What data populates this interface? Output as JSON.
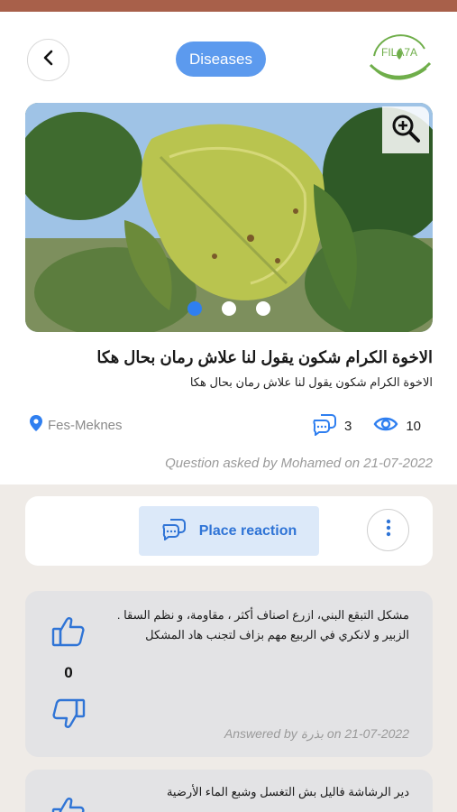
{
  "header": {
    "category_label": "Diseases",
    "logo_text": "FILA7A"
  },
  "post": {
    "title": "الاخوة الكرام شكون يقول لنا علاش رمان بحال هكا",
    "subtitle": "الاخوة الكرام  شكون يقول لنا علاش رمان بحال هكا",
    "location": "Fes-Meknes",
    "comments_count": "3",
    "views_count": "10",
    "asked_line": "Question asked by Mohamed on 21-07-2022",
    "carousel": {
      "total": 3,
      "active_index": 0
    }
  },
  "actions": {
    "reaction_label": "Place reaction"
  },
  "answers": [
    {
      "text": "مشكل التبقع البني، ازرع اصناف أكثر ، مقاومة، و نظم السقا . الزبير و لانكري في الربيع مهم بزاف لتجنب هاد المشكل",
      "votes": "0",
      "answered_line": "Answered by بذرة on 21-07-2022"
    },
    {
      "text": "دير الرشاشة فاليل بش التغسل وشبع الماء الأرضية"
    }
  ],
  "colors": {
    "accent": "#5c9aee",
    "top_bar": "#a8604a",
    "brand_green": "#6fae4a"
  }
}
